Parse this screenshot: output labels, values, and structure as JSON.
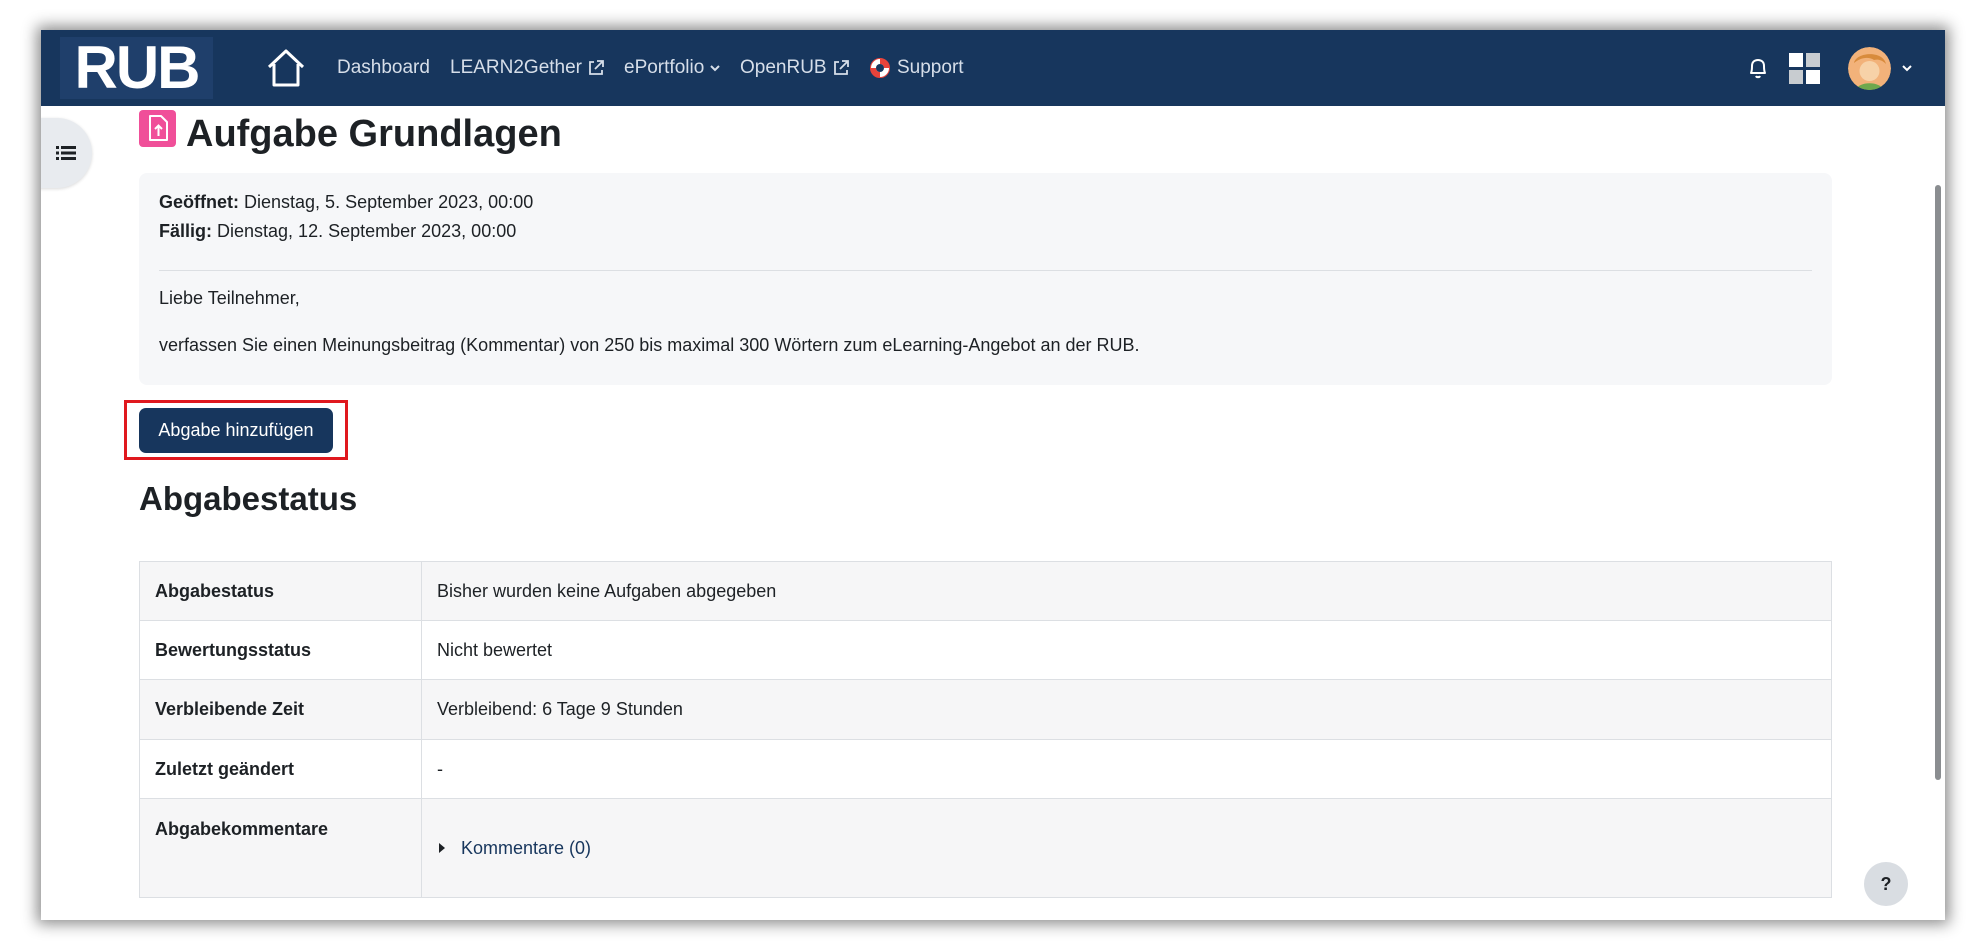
{
  "navbar": {
    "logo_text": "RUB",
    "items": [
      {
        "label": "Dashboard"
      },
      {
        "label": "LEARN2Gether"
      },
      {
        "label": "ePortfolio"
      },
      {
        "label": "OpenRUB"
      },
      {
        "label": "Support"
      }
    ]
  },
  "page": {
    "title": "Aufgabe Grundlagen",
    "opened_label": "Geöffnet:",
    "opened_value": "Dienstag, 5. September 2023, 00:00",
    "due_label": "Fällig:",
    "due_value": "Dienstag, 12. September 2023, 00:00",
    "greeting": "Liebe Teilnehmer,",
    "description": "verfassen Sie einen Meinungsbeitrag (Kommentar) von 250 bis maximal 300 Wörtern zum eLearning-Angebot an der RUB.",
    "add_button_label": "Abgabe hinzufügen"
  },
  "status": {
    "heading": "Abgabestatus",
    "rows": [
      {
        "label": "Abgabestatus",
        "value": "Bisher wurden keine Aufgaben abgegeben"
      },
      {
        "label": "Bewertungsstatus",
        "value": "Nicht bewertet"
      },
      {
        "label": "Verbleibende Zeit",
        "value": "Verbleibend: 6 Tage 9 Stunden"
      },
      {
        "label": "Zuletzt geändert",
        "value": "-"
      },
      {
        "label": "Abgabekommentare",
        "value": "Kommentare (0)"
      }
    ]
  },
  "help": {
    "label": "?"
  },
  "colors": {
    "navbar": "#17365d",
    "button": "#17365d",
    "highlight": "#e0181e",
    "assign_icon": "#f04f99"
  }
}
